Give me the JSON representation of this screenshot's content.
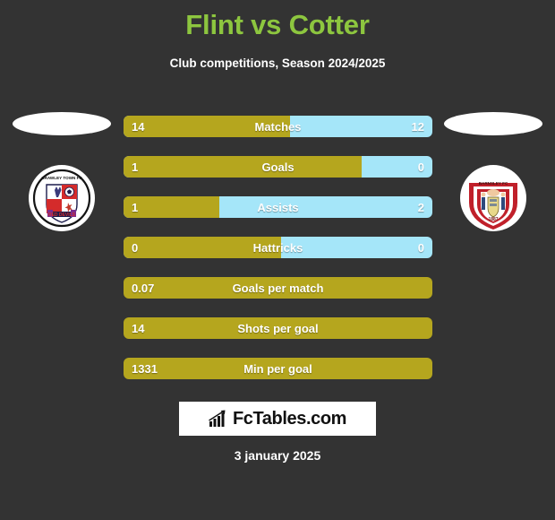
{
  "header": {
    "title": "Flint vs Cotter",
    "subtitle": "Club competitions, Season 2024/2025",
    "title_color": "#8dc63f"
  },
  "teams": {
    "home": {
      "name": "Crawley Town FC",
      "crest_text": "CRAWLEY TOWN FC",
      "crest_banner": "RED DEVILS"
    },
    "away": {
      "name": "Barnsley FC",
      "crest_text": "BARNSLEY FC",
      "crest_year": "1887"
    }
  },
  "colors": {
    "home_bar": "#b5a61e",
    "away_bar": "#a5e6f9",
    "background": "#333333"
  },
  "chart_data": {
    "type": "bar",
    "title": "Flint vs Cotter",
    "subtitle": "Club competitions, Season 2024/2025",
    "categories": [
      "Matches",
      "Goals",
      "Assists",
      "Hattricks",
      "Goals per match",
      "Shots per goal",
      "Min per goal"
    ],
    "series": [
      {
        "name": "Flint",
        "values": [
          "14",
          "1",
          "1",
          "0",
          "0.07",
          "14",
          "1331"
        ]
      },
      {
        "name": "Cotter",
        "values": [
          "12",
          "0",
          "2",
          "0",
          null,
          null,
          null
        ]
      }
    ],
    "rows": [
      {
        "label": "Matches",
        "home": "14",
        "away": "12",
        "home_pct": 54,
        "dual": true
      },
      {
        "label": "Goals",
        "home": "1",
        "away": "0",
        "home_pct": 77,
        "dual": true
      },
      {
        "label": "Assists",
        "home": "1",
        "away": "2",
        "home_pct": 31,
        "dual": true
      },
      {
        "label": "Hattricks",
        "home": "0",
        "away": "0",
        "home_pct": 51,
        "dual": true
      },
      {
        "label": "Goals per match",
        "home": "0.07",
        "away": "",
        "home_pct": 100,
        "dual": false
      },
      {
        "label": "Shots per goal",
        "home": "14",
        "away": "",
        "home_pct": 100,
        "dual": false
      },
      {
        "label": "Min per goal",
        "home": "1331",
        "away": "",
        "home_pct": 100,
        "dual": false
      }
    ]
  },
  "footer": {
    "brand": "FcTables.com",
    "date": "3 january 2025"
  }
}
